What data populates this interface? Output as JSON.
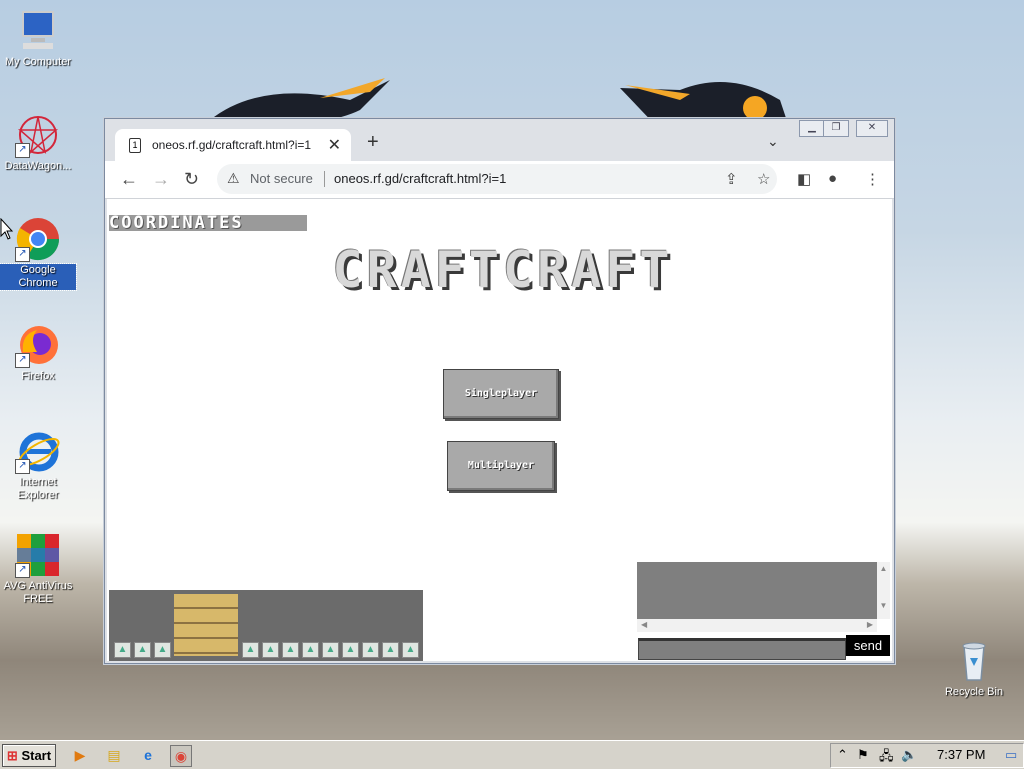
{
  "desktop": {
    "icons": [
      {
        "label": "My Computer"
      },
      {
        "label": "DataWagon..."
      },
      {
        "label": "Google Chrome"
      },
      {
        "label": "Firefox"
      },
      {
        "label": "Internet Explorer"
      },
      {
        "label": "AVG AntiVirus FREE"
      },
      {
        "label": "Recycle Bin"
      }
    ]
  },
  "browser": {
    "tab_title": "oneos.rf.gd/craftcraft.html?i=1",
    "tab_favicon": "1",
    "security_label": "Not secure",
    "url": "oneos.rf.gd/craftcraft.html?i=1"
  },
  "game": {
    "coordinates_label": "COORDINATES",
    "title": "CRAFTCRAFT",
    "singleplayer_label": "Singleplayer",
    "multiplayer_label": "Multiplayer",
    "send_label": "send",
    "chat_input_value": ""
  },
  "taskbar": {
    "start_label": "Start",
    "clock": "7:37 PM"
  },
  "colors": {
    "accent": "#2a5fb8",
    "game_gray": "#a9a9a9",
    "chat_bg": "#7f7f7f"
  }
}
